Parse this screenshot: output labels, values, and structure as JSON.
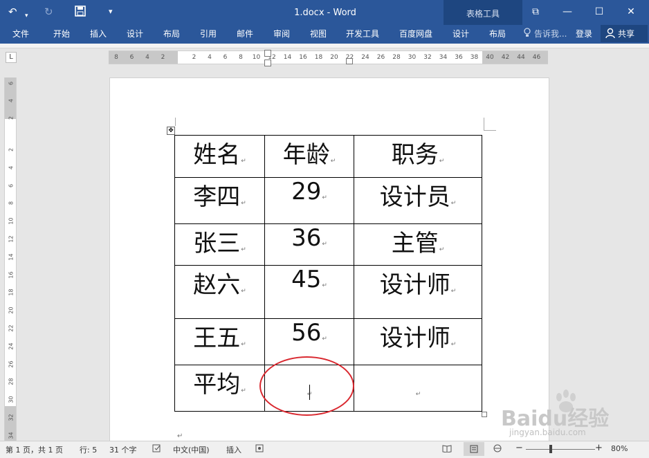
{
  "window": {
    "title": "1.docx - Word",
    "context_group": "表格工具"
  },
  "quick_access": {
    "undo_icon": "undo-icon",
    "redo_icon": "redo-icon",
    "save_icon": "save-icon",
    "customize_icon": "customize-icon"
  },
  "ribbon": {
    "tabs": [
      "文件",
      "开始",
      "插入",
      "设计",
      "布局",
      "引用",
      "邮件",
      "审阅",
      "视图",
      "开发工具",
      "百度网盘"
    ],
    "context_tabs": [
      "设计",
      "布局"
    ],
    "tell_me": "告诉我...",
    "login": "登录",
    "share": "共享"
  },
  "ruler": {
    "h_numbers": [
      "8",
      "6",
      "4",
      "2",
      "",
      "2",
      "4",
      "6",
      "8",
      "10",
      "12",
      "14",
      "16",
      "18",
      "20",
      "22",
      "24",
      "26",
      "28",
      "30",
      "32",
      "34",
      "36",
      "38",
      "40",
      "42",
      "44",
      "46"
    ],
    "v_numbers": [
      "6",
      "4",
      "2",
      "2",
      "4",
      "6",
      "8",
      "10",
      "12",
      "14",
      "16",
      "18",
      "20",
      "22",
      "24",
      "26",
      "28",
      "30",
      "32",
      "34"
    ]
  },
  "table": {
    "rows": [
      [
        "姓名",
        "年龄",
        "职务"
      ],
      [
        "李四",
        "29",
        "设计员"
      ],
      [
        "张三",
        "36",
        "主管"
      ],
      [
        "赵六",
        "45",
        "设计师"
      ],
      [
        "王五",
        "56",
        "设计师"
      ],
      [
        "平均",
        "",
        ""
      ]
    ]
  },
  "status": {
    "page": "第 1 页，共 1 页",
    "line": "行: 5",
    "words": "31 个字",
    "language": "中文(中国)",
    "mode": "插入",
    "zoom": "80%"
  },
  "watermark": {
    "brand": "Baidu经验",
    "url": "jingyan.baidu.com"
  },
  "colors": {
    "ribbon": "#2b579a",
    "annotation": "#d9282f"
  }
}
